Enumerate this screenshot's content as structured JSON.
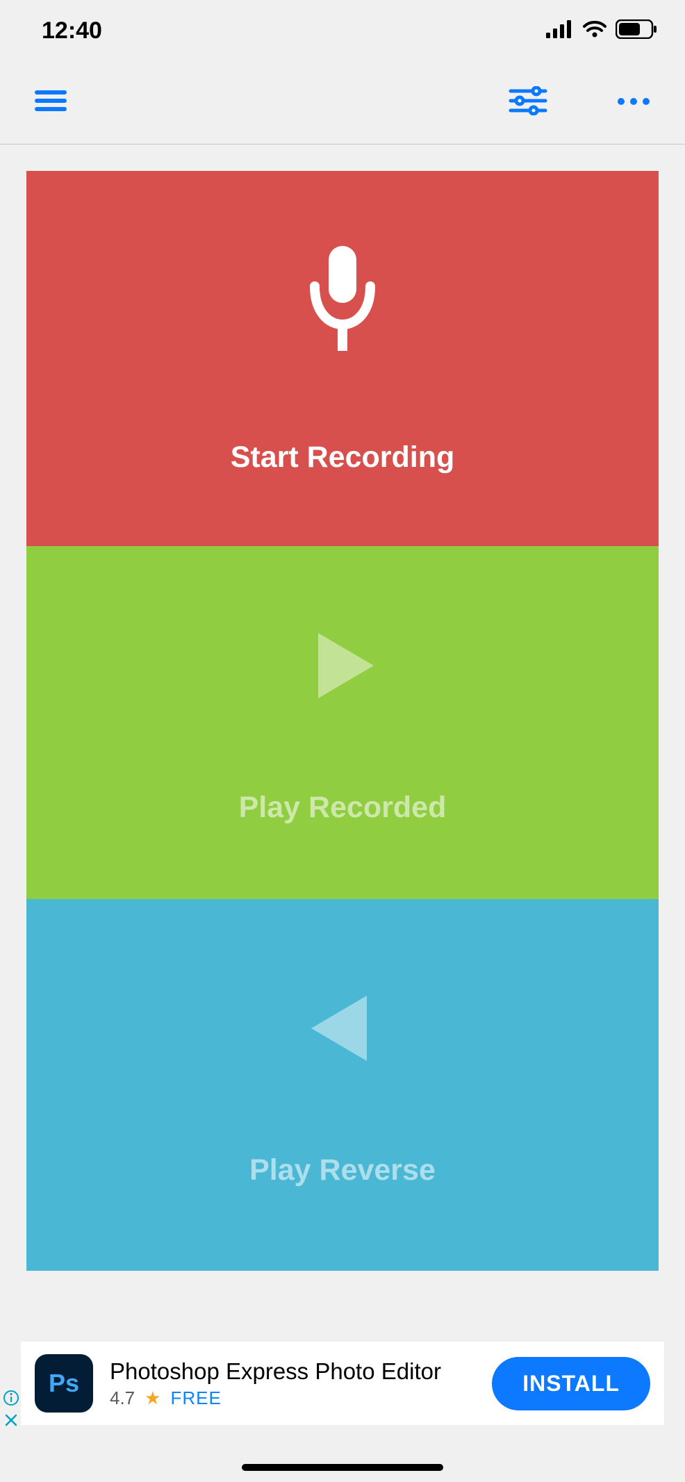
{
  "status": {
    "time": "12:40"
  },
  "panels": {
    "record": {
      "label": "Start Recording"
    },
    "play": {
      "label": "Play Recorded"
    },
    "reverse": {
      "label": "Play Reverse"
    }
  },
  "ad": {
    "badge": "Ps",
    "title": "Photoshop Express Photo Editor",
    "rating": "4.7",
    "price": "FREE",
    "cta": "INSTALL"
  }
}
